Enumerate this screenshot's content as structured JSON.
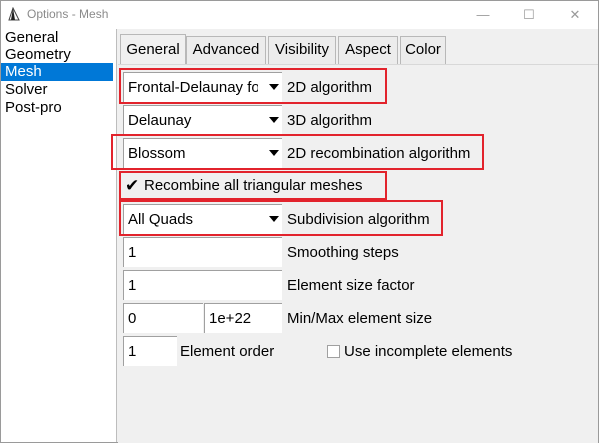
{
  "window": {
    "title": "Options - Mesh",
    "minimize": "—",
    "maximize": "☐",
    "close": "✕"
  },
  "sidebar": {
    "items": [
      {
        "label": "General"
      },
      {
        "label": "Geometry"
      },
      {
        "label": "Mesh",
        "selected": true
      },
      {
        "label": "Solver"
      },
      {
        "label": "Post-pro"
      }
    ]
  },
  "tabs": [
    {
      "label": "General",
      "active": true
    },
    {
      "label": "Advanced"
    },
    {
      "label": "Visibility"
    },
    {
      "label": "Aspect"
    },
    {
      "label": "Color"
    }
  ],
  "general": {
    "algo2d": {
      "value": "Frontal-Delaunay for Quads",
      "label": "2D algorithm"
    },
    "algo3d": {
      "value": "Delaunay",
      "label": "3D algorithm"
    },
    "recomb2d": {
      "value": "Blossom",
      "label": "2D recombination algorithm"
    },
    "recombine_all": {
      "label": "Recombine all triangular meshes",
      "checked": true
    },
    "subdivision": {
      "value": "All Quads",
      "label": "Subdivision algorithm"
    },
    "smoothing": {
      "value": "1",
      "label": "Smoothing steps"
    },
    "size_factor": {
      "value": "1",
      "label": "Element size factor"
    },
    "minmax": {
      "min": "0",
      "max": "1e+22",
      "label": "Min/Max element size"
    },
    "order": {
      "value": "1",
      "label": "Element order"
    },
    "incomplete": {
      "label": "Use incomplete elements",
      "checked": false
    }
  },
  "colors": {
    "highlight": "#e2232c",
    "selection": "#0078d7"
  }
}
